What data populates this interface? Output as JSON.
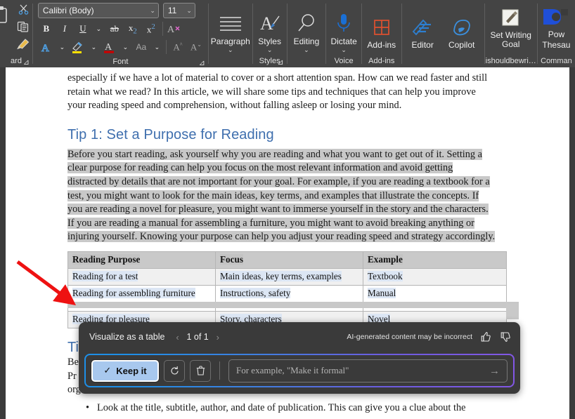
{
  "ribbon": {
    "clipboard": {
      "label": "ard",
      "dialog_launcher": "⊿",
      "items": [
        {
          "name": "cut",
          "glyph": "✂"
        },
        {
          "name": "copy",
          "glyph": "❐"
        },
        {
          "name": "format-painter",
          "glyph": "🖌"
        }
      ]
    },
    "font": {
      "label": "Font",
      "dialog_launcher": "⊿",
      "font_name": "Calibri (Body)",
      "font_size": "11",
      "buttons": [
        {
          "name": "bold",
          "glyph": "B"
        },
        {
          "name": "italic",
          "glyph": "I"
        },
        {
          "name": "underline",
          "glyph": "U"
        },
        {
          "name": "underline-dropdown",
          "glyph": "⌄"
        },
        {
          "name": "strikethrough",
          "glyph": "ab"
        },
        {
          "name": "subscript",
          "glyph": "x₂"
        },
        {
          "name": "superscript",
          "glyph": "x²"
        },
        {
          "name": "clear-formatting",
          "glyph": "A"
        },
        {
          "name": "text-effects",
          "glyph": "A"
        },
        {
          "name": "text-effects-dropdown",
          "glyph": "⌄"
        },
        {
          "name": "text-highlight-color",
          "glyph": "✐"
        },
        {
          "name": "highlight-dropdown",
          "glyph": "⌄"
        },
        {
          "name": "font-color",
          "glyph": "A"
        },
        {
          "name": "font-color-dropdown",
          "glyph": "⌄"
        },
        {
          "name": "change-case",
          "glyph": "Aa"
        },
        {
          "name": "change-case-dropdown",
          "glyph": "⌄"
        },
        {
          "name": "grow-font",
          "glyph": "A"
        },
        {
          "name": "shrink-font",
          "glyph": "A"
        }
      ],
      "highlight_color": "#ffe000",
      "font_color": "#cc0000"
    },
    "paragraph": {
      "label": "Paragraph",
      "caret": "⌄"
    },
    "styles": {
      "label": "Styles",
      "group_label": "Styles",
      "caret": "⌄",
      "dialog_launcher": "⊿"
    },
    "editing": {
      "label": "Editing",
      "caret": "⌄"
    },
    "voice": {
      "label": "Dictate",
      "group_label": "Voice",
      "caret": "⌄"
    },
    "addins": {
      "label": "Add-ins",
      "group_label": "Add-ins"
    },
    "editor": {
      "label": "Editor"
    },
    "copilot": {
      "label": "Copilot"
    },
    "writing_goal": {
      "label": "Set Writing Goal",
      "group_label": "ishouldbewri…"
    },
    "power_thesaurus": {
      "label": "Pow",
      "label2": "Thesau",
      "group_label": "Comman"
    }
  },
  "document": {
    "intro_lines": [
      "especially if we have a lot of material to cover or a short attention span. How can we read faster and still",
      "retain what we read? In this article, we will share some tips and techniques that can help you improve",
      "your reading speed and comprehension, without falling asleep or losing your mind."
    ],
    "heading1": "Tip 1: Set a Purpose for Reading",
    "selected_lines": [
      "Before you start reading, ask yourself why you are reading and what you want to get out of it. Setting a",
      "clear purpose for reading can help you focus on the most relevant information and avoid getting",
      "distracted by details that are not important for your goal. For example, if you are reading a textbook for a",
      "test, you might want to look for the main ideas, key terms, and examples that illustrate the concepts. If",
      "you are reading a novel for pleasure, you might want to immerse yourself in the story and the characters.",
      "If you are reading a manual for assembling a furniture, you might want to avoid breaking anything or",
      "injuring yourself. Knowing your purpose can help you adjust your reading speed and strategy accordingly."
    ],
    "table": {
      "headers": [
        "Reading Purpose",
        "Focus",
        "Example"
      ],
      "rows": [
        [
          "Reading for a test",
          "Main ideas, key terms, examples",
          "Textbook"
        ],
        [
          "Reading for assembling furniture",
          "Instructions, safety",
          "Manual"
        ],
        [
          "Reading for pleasure",
          "Story, characters",
          "Novel"
        ]
      ]
    },
    "occluded_heading": "Ti",
    "occluded_lines": [
      "Be",
      "Pr",
      "org"
    ],
    "bullet_marker": "•",
    "bullet_text": "Look at the title, subtitle, author, and date of publication. This can give you a clue about the"
  },
  "copilot_panel": {
    "title": "Visualize as a table",
    "prev_chevron": "‹",
    "next_chevron": "›",
    "page_indicator": "1 of 1",
    "disclaimer": "AI-generated content may be incorrect",
    "thumbs_up": "👍",
    "thumbs_down": "👎",
    "keep_label": "Keep it",
    "keep_check": "✓",
    "regenerate_glyph": "⟳",
    "delete_glyph": "🗑",
    "prompt_placeholder": "For example, \"Make it formal\"",
    "send_glyph": "→",
    "gradient_start": "#1e8fe8",
    "gradient_end": "#8257e5",
    "keep_bg": "#a8c8ee"
  },
  "annotation": {
    "arrow_color": "#ee1111",
    "name": "red-arrow"
  }
}
